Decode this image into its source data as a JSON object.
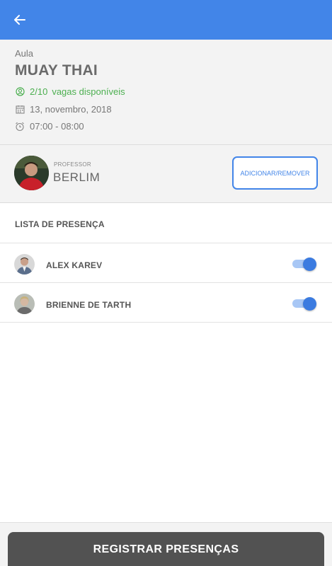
{
  "app_bar": {
    "back_icon": "arrow-back-icon",
    "color": "#4285e8"
  },
  "class_info": {
    "label": "Aula",
    "title": "MUAY THAI",
    "vacancies_count": "2/10",
    "vacancies_text": "vagas disponíveis",
    "date": "13, novembro, 2018",
    "time": "07:00 - 08:00",
    "icons": [
      "user-circle-icon",
      "calendar-icon",
      "alarm-clock-icon"
    ]
  },
  "professor": {
    "caption": "PROFESSOR",
    "name": "BERLIM",
    "action_label": "ADICIONAR/REMOVER"
  },
  "attendance": {
    "header": "LISTA DE PRESENÇA",
    "students": [
      {
        "name": "ALEX KAREV",
        "present": true
      },
      {
        "name": "BRIENNE DE TARTH",
        "present": true
      }
    ]
  },
  "footer": {
    "register_label": "REGISTRAR PRESENÇAS"
  },
  "colors": {
    "primary": "#4285e8",
    "success": "#4caf50",
    "button_dark": "#525252"
  }
}
